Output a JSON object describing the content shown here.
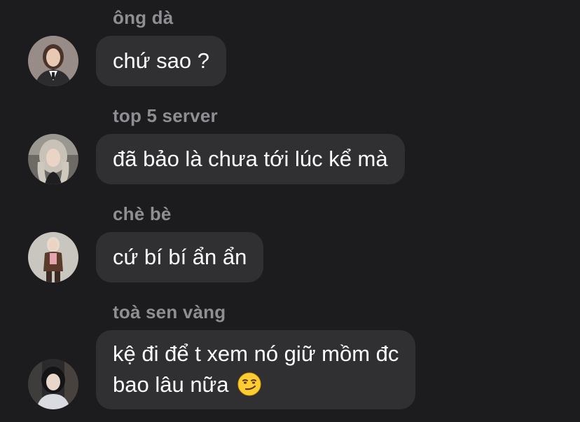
{
  "messages": [
    {
      "sender": "ông dà",
      "text": "chứ sao ?",
      "avatar": "avatar-woman-suit"
    },
    {
      "sender": "top 5 server",
      "text": "đã bảo là chưa tới lúc kể mà",
      "avatar": "avatar-woman-grey-hair"
    },
    {
      "sender": "chè bè",
      "text": "cứ bí bí ẩn ẩn",
      "avatar": "avatar-woman-brown-jacket"
    },
    {
      "sender": "toà sen vàng",
      "line1": "kệ đi để t xem nó giữ mồm đc",
      "line2": "bao lâu nữa",
      "emoji": "smirking-face-emoji",
      "avatar": "avatar-woman-dark-hair"
    }
  ],
  "colors": {
    "background": "#1c1c1e",
    "bubble": "#303033",
    "sender_name": "#8e8e93",
    "message_text": "#ffffff"
  }
}
